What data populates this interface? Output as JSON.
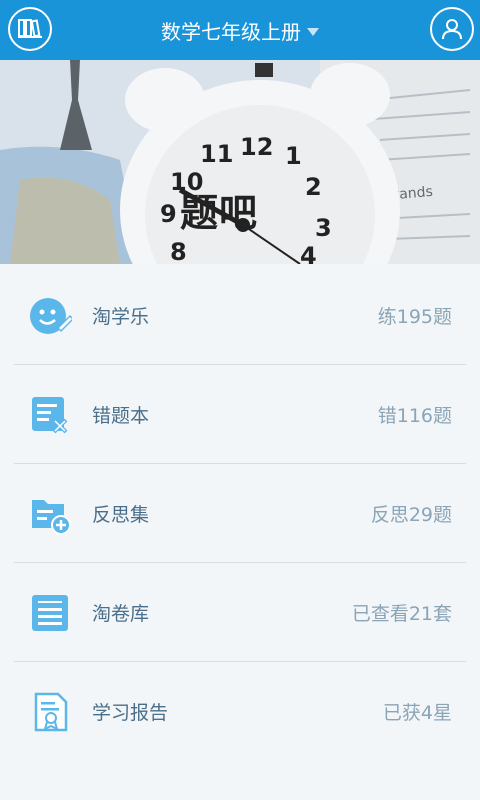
{
  "header": {
    "title": "数学七年级上册",
    "left_icon": "bookshelf-icon",
    "right_icon": "user-icon"
  },
  "banner": {
    "brand_text": "题吧",
    "clock_text": "brands"
  },
  "menu": [
    {
      "label": "淘学乐",
      "stat": "练195题",
      "icon": "smile-pencil-icon"
    },
    {
      "label": "错题本",
      "stat": "错116题",
      "icon": "wrong-notebook-icon"
    },
    {
      "label": "反思集",
      "stat": "反思29题",
      "icon": "folder-add-icon"
    },
    {
      "label": "淘卷库",
      "stat": "已查看21套",
      "icon": "paper-list-icon"
    },
    {
      "label": "学习报告",
      "stat": "已获4星",
      "icon": "certificate-icon"
    }
  ],
  "colors": {
    "header_bg": "#1a94d9",
    "icon_blue": "#5bb6ea",
    "label_text": "#4b6f8a",
    "stat_text": "#8ba4b6",
    "page_bg": "#f2f6f9"
  }
}
